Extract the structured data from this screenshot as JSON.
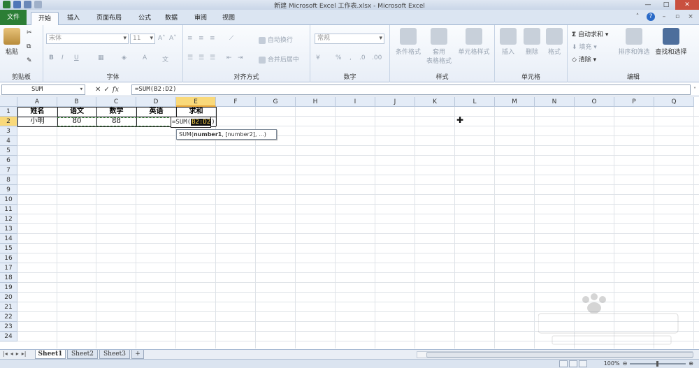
{
  "window": {
    "title": "新建 Microsoft Excel 工作表.xlsx - Microsoft Excel",
    "controls": [
      "—",
      "□",
      "✕"
    ]
  },
  "tabs": [
    "文件",
    "开始",
    "插入",
    "页面布局",
    "公式",
    "数据",
    "审阅",
    "视图"
  ],
  "active_tab": "开始",
  "ribbon": {
    "clipboard": {
      "paste": "粘贴",
      "label": "剪贴板"
    },
    "font": {
      "font_name": "宋体",
      "font_size": "11",
      "label": "字体"
    },
    "alignment": {
      "wrap": "自动换行",
      "merge": "合并后居中",
      "label": "对齐方式"
    },
    "number": {
      "format": "常规",
      "label": "数字"
    },
    "styles": {
      "cond": "条件格式",
      "table1": "套用",
      "table2": "表格格式",
      "cell": "单元格样式",
      "label": "样式"
    },
    "cells": {
      "insert": "插入",
      "delete": "删除",
      "format": "格式",
      "label": "单元格"
    },
    "editing": {
      "autosum": "自动求和",
      "fill": "填充",
      "clear": "清除",
      "sort": "排序和筛选",
      "find": "查找和选择",
      "label": "编辑"
    }
  },
  "formula_bar": {
    "name_box": "SUM",
    "fx": "fx",
    "formula": "=SUM(B2:D2)"
  },
  "columns": [
    "A",
    "B",
    "C",
    "D",
    "E",
    "F",
    "G",
    "H",
    "I",
    "J",
    "K",
    "L",
    "M",
    "N",
    "O",
    "P",
    "Q"
  ],
  "rows": [
    "1",
    "2",
    "3",
    "4",
    "5",
    "6",
    "7",
    "8",
    "9",
    "10",
    "11",
    "12",
    "13",
    "14",
    "15",
    "16",
    "17",
    "18",
    "19",
    "20",
    "21",
    "22",
    "23",
    "24"
  ],
  "cells": {
    "A1": "姓名",
    "B1": "语文",
    "C1": "数学",
    "D1": "英语",
    "E1": "求和",
    "A2": "小明",
    "B2": "80",
    "C2": "88"
  },
  "edit_cell": {
    "prefix": "=SUM(",
    "range": "B2:D2",
    "suffix": ")"
  },
  "tooltip": {
    "fn": "SUM(",
    "arg1": "number1",
    "rest": ", [number2], ...)"
  },
  "sheets": [
    "Sheet1",
    "Sheet2",
    "Sheet3"
  ],
  "active_sheet": "Sheet1",
  "status": {
    "zoom": "100%"
  }
}
